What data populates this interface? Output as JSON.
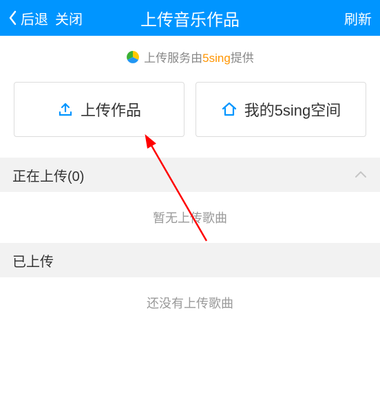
{
  "header": {
    "back_label": "后退",
    "close_label": "关闭",
    "title": "上传音乐作品",
    "refresh_label": "刷新"
  },
  "provider": {
    "prefix": "上传服务由",
    "brand": "5sing",
    "suffix": "提供"
  },
  "buttons": {
    "upload_label": "上传作品",
    "space_label": "我的5sing空间"
  },
  "sections": {
    "uploading": {
      "label": "正在上传(0)",
      "empty": "暂无上传歌曲"
    },
    "uploaded": {
      "label": "已上传",
      "empty": "还没有上传歌曲"
    }
  },
  "colors": {
    "primary": "#0095ff",
    "brand_orange": "#ff9500"
  }
}
